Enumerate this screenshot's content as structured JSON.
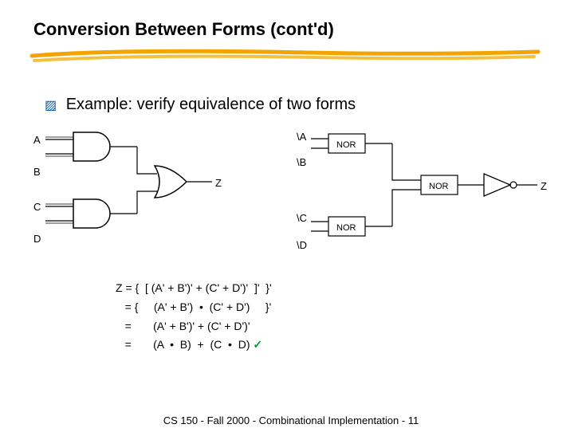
{
  "title": "Conversion Between Forms (cont'd)",
  "section_text": "Example: verify equivalence of two forms",
  "labels": {
    "A": "A",
    "B": "B",
    "C": "C",
    "D": "D",
    "Z": "Z",
    "nA": "\\A",
    "nB": "\\B",
    "nC": "\\C",
    "nD": "\\D",
    "NOR": "NOR"
  },
  "derivation": {
    "l1": "Z = {  [ (A' + B')' + (C' + D')'  ]'  }'",
    "l2": "   = {     (A' + B')  •  (C' + D')     }'",
    "l3": "   =       (A' + B')' + (C' + D')'",
    "l4_pre": "   =       (A  •  B)  +  (C  •  D) ",
    "check": "✓"
  },
  "footer": "CS 150 - Fall 2000 - Combinational Implementation - 11"
}
